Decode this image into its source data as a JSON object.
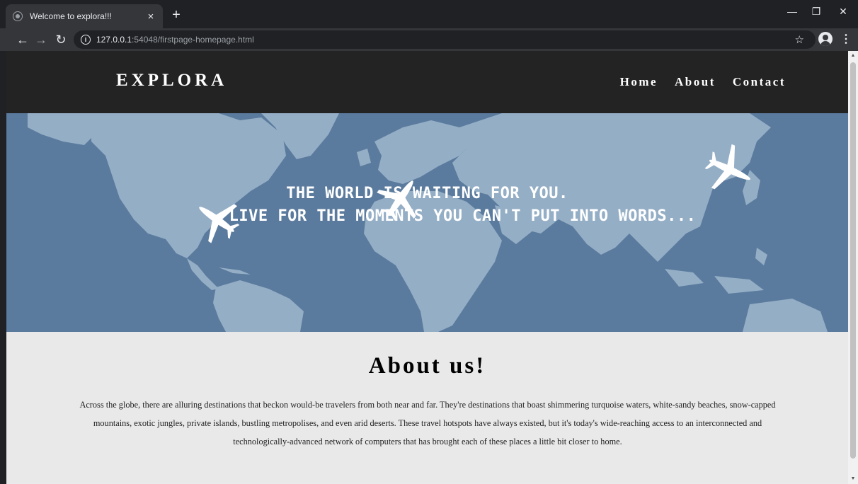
{
  "browser": {
    "tab_title": "Welcome to explora!!!",
    "tab_close": "×",
    "new_tab": "+",
    "url_host": "127.0.0.1",
    "url_path": ":54048/firstpage-homepage.html",
    "icons": [
      "back-arrow-icon",
      "forward-arrow-icon",
      "reload-icon",
      "info-icon",
      "star-icon",
      "profile-icon",
      "kebab-menu-icon",
      "minimize-icon",
      "restore-icon",
      "close-icon"
    ]
  },
  "header": {
    "logo": "EXPLORA",
    "nav": [
      {
        "label": "Home"
      },
      {
        "label": "About"
      },
      {
        "label": "Contact"
      }
    ]
  },
  "hero": {
    "line1": "THE WORLD IS WAITING FOR YOU.",
    "line2": "LIVE FOR THE MOMENTS YOU CAN'T PUT INTO WORDS..."
  },
  "about": {
    "heading": "About us!",
    "body": "Across the globe, there are alluring destinations that beckon would-be travelers from both near and far. They're destinations that boast shimmering turquoise waters, white-sandy beaches, snow-capped mountains, exotic jungles, private islands, bustling metropolises, and even arid deserts. These travel hotspots have always existed, but it's today's wide-reaching access to an interconnected and technologically-advanced network of computers that has brought each of these places a little bit closer to home."
  },
  "colors": {
    "chrome_dark": "#202124",
    "chrome_toolbar": "#35363a",
    "header_bg": "#232323",
    "ocean": "#5b7b9e",
    "land": "#94aec6",
    "about_bg": "#e9e9e9"
  }
}
